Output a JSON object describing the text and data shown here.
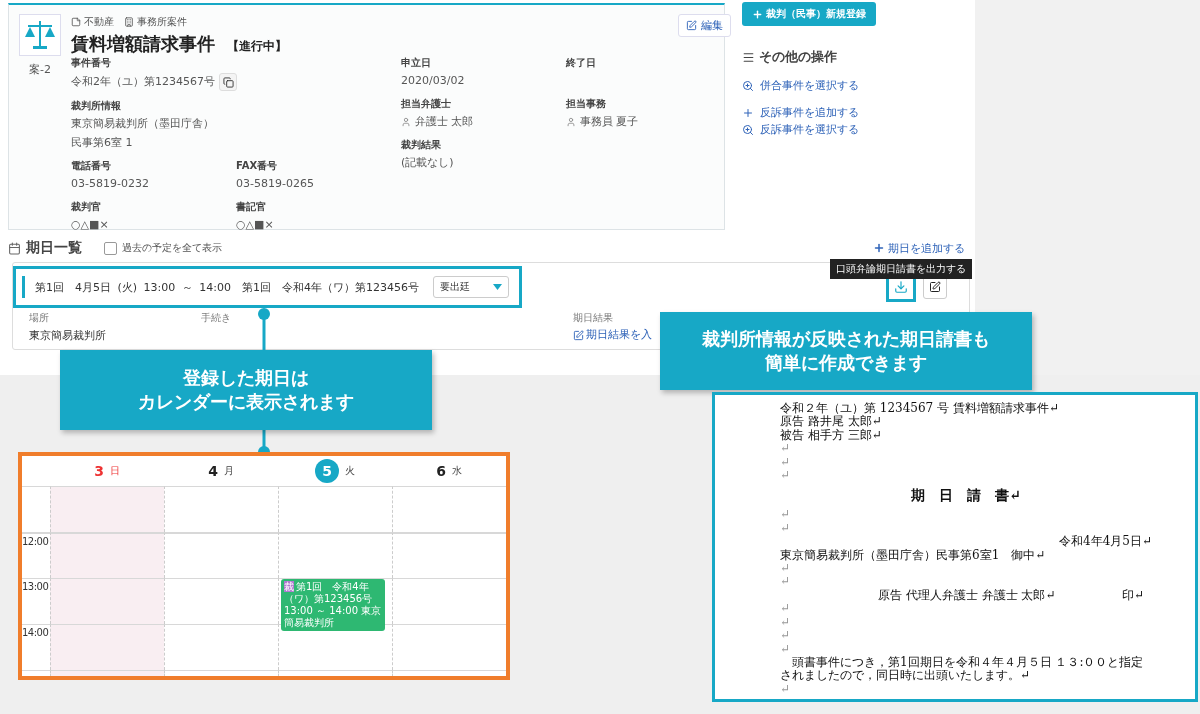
{
  "case": {
    "tags": [
      {
        "kind": "category",
        "label": "不動産"
      },
      {
        "kind": "office",
        "label": "事務所案件"
      }
    ],
    "case_id": "案-2",
    "title": "賃料増額請求事件",
    "status": "【進行中】",
    "edit_button": "編集",
    "left_rows": [
      [
        {
          "kind": "copyable",
          "label": "事件番号",
          "lines": [
            "令和2年（ユ）第1234567号"
          ]
        }
      ],
      [
        {
          "kind": "text",
          "label": "裁判所情報",
          "lines": [
            "東京簡易裁判所（墨田庁舎）",
            "民事第6室 1"
          ]
        }
      ],
      [
        {
          "kind": "text",
          "label": "電話番号",
          "lines": [
            "03-5819-0232"
          ]
        },
        {
          "kind": "text",
          "label": "FAX番号",
          "lines": [
            "03-5819-0265"
          ]
        }
      ],
      [
        {
          "kind": "text",
          "label": "裁判官",
          "lines": [
            "○△■×"
          ]
        },
        {
          "kind": "text",
          "label": "書記官",
          "lines": [
            "○△■×"
          ]
        }
      ]
    ],
    "right_rows": [
      [
        {
          "kind": "text",
          "label": "申立日",
          "lines": [
            "2020/03/02"
          ]
        },
        {
          "label": "終了日"
        }
      ],
      [
        {
          "kind": "person",
          "label": "担当弁護士",
          "lines": [
            "弁護士 太郎"
          ]
        },
        {
          "kind": "person",
          "label": "担当事務",
          "lines": [
            "事務員 夏子"
          ]
        }
      ],
      [
        {
          "kind": "text",
          "label": "裁判結果",
          "lines": [
            "(記載なし)"
          ]
        }
      ]
    ]
  },
  "sidebar": {
    "register_button": "裁判（民事）新規登録",
    "other_title": "その他の操作",
    "action_groups": [
      [
        {
          "kind": "search",
          "label": "併合事件を選択する"
        }
      ],
      [
        {
          "kind": "add",
          "label": "反訴事件を追加する"
        },
        {
          "kind": "search",
          "label": "反訴事件を選択する"
        }
      ]
    ]
  },
  "schedule": {
    "title": "期日一覧",
    "past_toggle": {
      "label": "過去の予定を全て表示",
      "checked": false
    },
    "add_link": "期日を追加する",
    "hearing": {
      "summary": "第1回　4月5日 (火) 13:00 ～ 14:00　第1回　令和4年（ワ）第123456号",
      "attendance": "要出廷",
      "tooltip": "口頭弁論期日請書を出力する",
      "details": [
        {
          "kind": "text",
          "label": "場所",
          "value": "東京簡易裁判所"
        },
        {
          "label": "手続き"
        },
        {
          "kind": "link",
          "label": "期日結果",
          "value": "期日結果を入"
        }
      ]
    }
  },
  "callouts": [
    {
      "lines": [
        "登録した期日は",
        "カレンダーに表示されます"
      ]
    },
    {
      "lines": [
        "裁判所情報が反映された期日請書も",
        "簡単に作成できます"
      ]
    }
  ],
  "calendar": {
    "times": [
      "12:00",
      "13:00",
      "14:00"
    ],
    "days": [
      {
        "kind": "sunday",
        "date": "3",
        "weekday": "日",
        "selected": false
      },
      {
        "kind": "weekday",
        "date": "4",
        "weekday": "月",
        "selected": false
      },
      {
        "kind": "weekday",
        "date": "5",
        "weekday": "火",
        "selected": true,
        "events": [
          {
            "start": "13:00",
            "badge": "裁",
            "title": "第1回　令和4年（ワ）第123456号",
            "until": "～ 14:00",
            "place": "東京簡易裁判所",
            "color": "#2eb872"
          }
        ]
      },
      {
        "kind": "weekday",
        "date": "6",
        "weekday": "水",
        "selected": false
      }
    ]
  },
  "document": {
    "lines": [
      {
        "kind": "text",
        "text": "令和２年（ユ）第 1234567 号 賃料増額請求事件↵"
      },
      {
        "kind": "text",
        "text": "原告  路井尾  太郎↵"
      },
      {
        "kind": "text",
        "text": "被告  相手方  三郎↵"
      },
      {
        "kind": "blank",
        "text": "↵"
      },
      {
        "kind": "blank",
        "text": "↵"
      },
      {
        "kind": "blank",
        "text": "↵"
      },
      {
        "kind": "title",
        "text": "期　日　請　書↵"
      },
      {
        "kind": "blank",
        "text": "↵"
      },
      {
        "kind": "blank",
        "text": "↵"
      },
      {
        "kind": "right",
        "text": "令和4年4月5日↵"
      },
      {
        "kind": "text",
        "text": "東京簡易裁判所（墨田庁舎）民事第6室1　御中↵"
      },
      {
        "kind": "blank",
        "text": "↵"
      },
      {
        "kind": "blank",
        "text": "↵"
      },
      {
        "kind": "signature",
        "text": "原告  代理人弁護士  弁護士  太郎↵",
        "seal": "印↵"
      },
      {
        "kind": "blank",
        "text": "↵"
      },
      {
        "kind": "blank",
        "text": "↵"
      },
      {
        "kind": "blank",
        "text": "↵"
      },
      {
        "kind": "blank",
        "text": "↵"
      },
      {
        "kind": "paragraph",
        "text": "頭書事件につき，第1回期日を令和４年４月５日 １３:００と指定されましたので，同日時に出頭いたします。↵"
      },
      {
        "kind": "blank",
        "text": "↵"
      }
    ]
  }
}
